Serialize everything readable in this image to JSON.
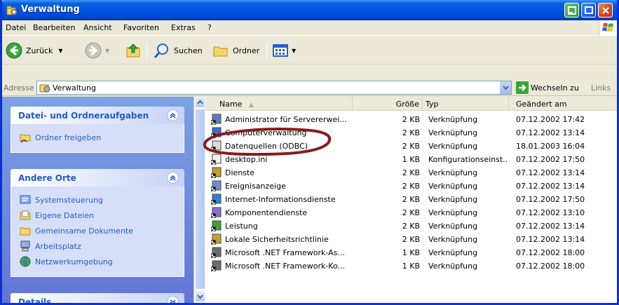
{
  "window": {
    "title": "Verwaltung"
  },
  "menu": {
    "items": [
      "Datei",
      "Bearbeiten",
      "Ansicht",
      "Favoriten",
      "Extras",
      "?"
    ]
  },
  "toolbar": {
    "back_label": "Zurück",
    "search_label": "Suchen",
    "folders_label": "Ordner"
  },
  "address": {
    "label": "Adresse",
    "value": "Verwaltung",
    "go_label": "Wechseln zu",
    "links_label": "Links"
  },
  "taskpane": {
    "file_tasks": {
      "title": "Datei- und Ordneraufgaben",
      "items": [
        "Ordner freigeben"
      ]
    },
    "other_places": {
      "title": "Andere Orte",
      "items": [
        "Systemsteuerung",
        "Eigene Dateien",
        "Gemeinsame Dokumente",
        "Arbeitsplatz",
        "Netzwerkumgebung"
      ]
    },
    "details": {
      "title": "Details"
    }
  },
  "filelist": {
    "columns": {
      "name": "Name",
      "size": "Größe",
      "type": "Typ",
      "modified": "Geändert am"
    },
    "rows": [
      {
        "name": "Administrator für Servererwei...",
        "size": "2 KB",
        "type": "Verknüpfung",
        "modified": "07.12.2002 17:42"
      },
      {
        "name": "Computerverwaltung",
        "size": "2 KB",
        "type": "Verknüpfung",
        "modified": "07.12.2002 13:14"
      },
      {
        "name": "Datenquellen (ODBC)",
        "size": "2 KB",
        "type": "Verknüpfung",
        "modified": "18.01.2003 16:04"
      },
      {
        "name": "desktop.ini",
        "size": "1 KB",
        "type": "Konfigurationseinst...",
        "modified": "07.12.2002 17:50"
      },
      {
        "name": "Dienste",
        "size": "2 KB",
        "type": "Verknüpfung",
        "modified": "07.12.2002 13:14"
      },
      {
        "name": "Ereignisanzeige",
        "size": "2 KB",
        "type": "Verknüpfung",
        "modified": "07.12.2002 13:14"
      },
      {
        "name": "Internet-Informationsdienste",
        "size": "2 KB",
        "type": "Verknüpfung",
        "modified": "07.12.2002 17:50"
      },
      {
        "name": "Komponentendienste",
        "size": "2 KB",
        "type": "Verknüpfung",
        "modified": "07.12.2002 13:10"
      },
      {
        "name": "Leistung",
        "size": "2 KB",
        "type": "Verknüpfung",
        "modified": "07.12.2002 13:14"
      },
      {
        "name": "Lokale Sicherheitsrichtlinie",
        "size": "2 KB",
        "type": "Verknüpfung",
        "modified": "07.12.2002 13:14"
      },
      {
        "name": "Microsoft .NET Framework-As...",
        "size": "1 KB",
        "type": "Verknüpfung",
        "modified": "07.12.2002 18:00"
      },
      {
        "name": "Microsoft .NET Framework-Ko...",
        "size": "1 KB",
        "type": "Verknüpfung",
        "modified": "07.12.2002 18:00"
      }
    ]
  },
  "colors": {
    "titlebar": "#0054e3",
    "taskpane_link": "#215dc6",
    "annotation": "#8b1a1a"
  }
}
